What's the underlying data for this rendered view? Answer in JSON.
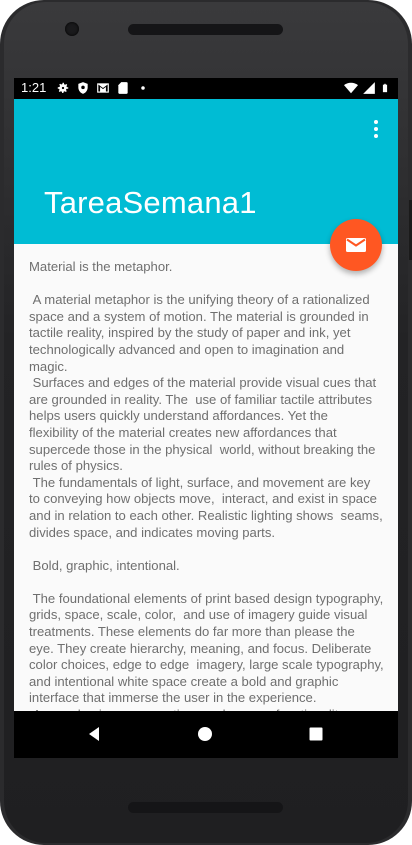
{
  "status_bar": {
    "time": "1:21",
    "left_icons": [
      "settings-icon",
      "shield-icon",
      "gmail-icon",
      "sd-card-icon",
      "notification-dot-icon"
    ],
    "right_icons": [
      "wifi-icon",
      "signal-icon",
      "battery-icon"
    ]
  },
  "app_bar": {
    "title": "TareaSemana1",
    "background_color": "#00bcd4",
    "menu_icon": "overflow-menu-icon"
  },
  "fab": {
    "icon": "email-icon",
    "color": "#ff5722"
  },
  "content": {
    "body": "Material is the metaphor.\n\n A material metaphor is the unifying theory of a rationalized space and a system of motion. The material is grounded in tactile reality, inspired by the study of paper and ink, yet  technologically advanced and open to imagination and magic.\n Surfaces and edges of the material provide visual cues that are grounded in reality. The  use of familiar tactile attributes helps users quickly understand affordances. Yet the  flexibility of the material creates new affordances that supercede those in the physical  world, without breaking the rules of physics.\n The fundamentals of light, surface, and movement are key to conveying how objects move,  interact, and exist in space and in relation to each other. Realistic lighting shows  seams, divides space, and indicates moving parts.\n\n Bold, graphic, intentional.\n\n The foundational elements of print based design typography, grids, space, scale, color,  and use of imagery guide visual treatments. These elements do far more than please the  eye. They create hierarchy, meaning, and focus. Deliberate color choices, edge to edge  imagery, large scale typography, and intentional white space create a bold and graphic  interface that immerse the user in the experience.\n An emphasis on user actions makes core functionality immediately apparent and provides  waypoints for the user."
  },
  "nav_bar": {
    "buttons": [
      "back-icon",
      "home-icon",
      "recents-icon"
    ]
  }
}
